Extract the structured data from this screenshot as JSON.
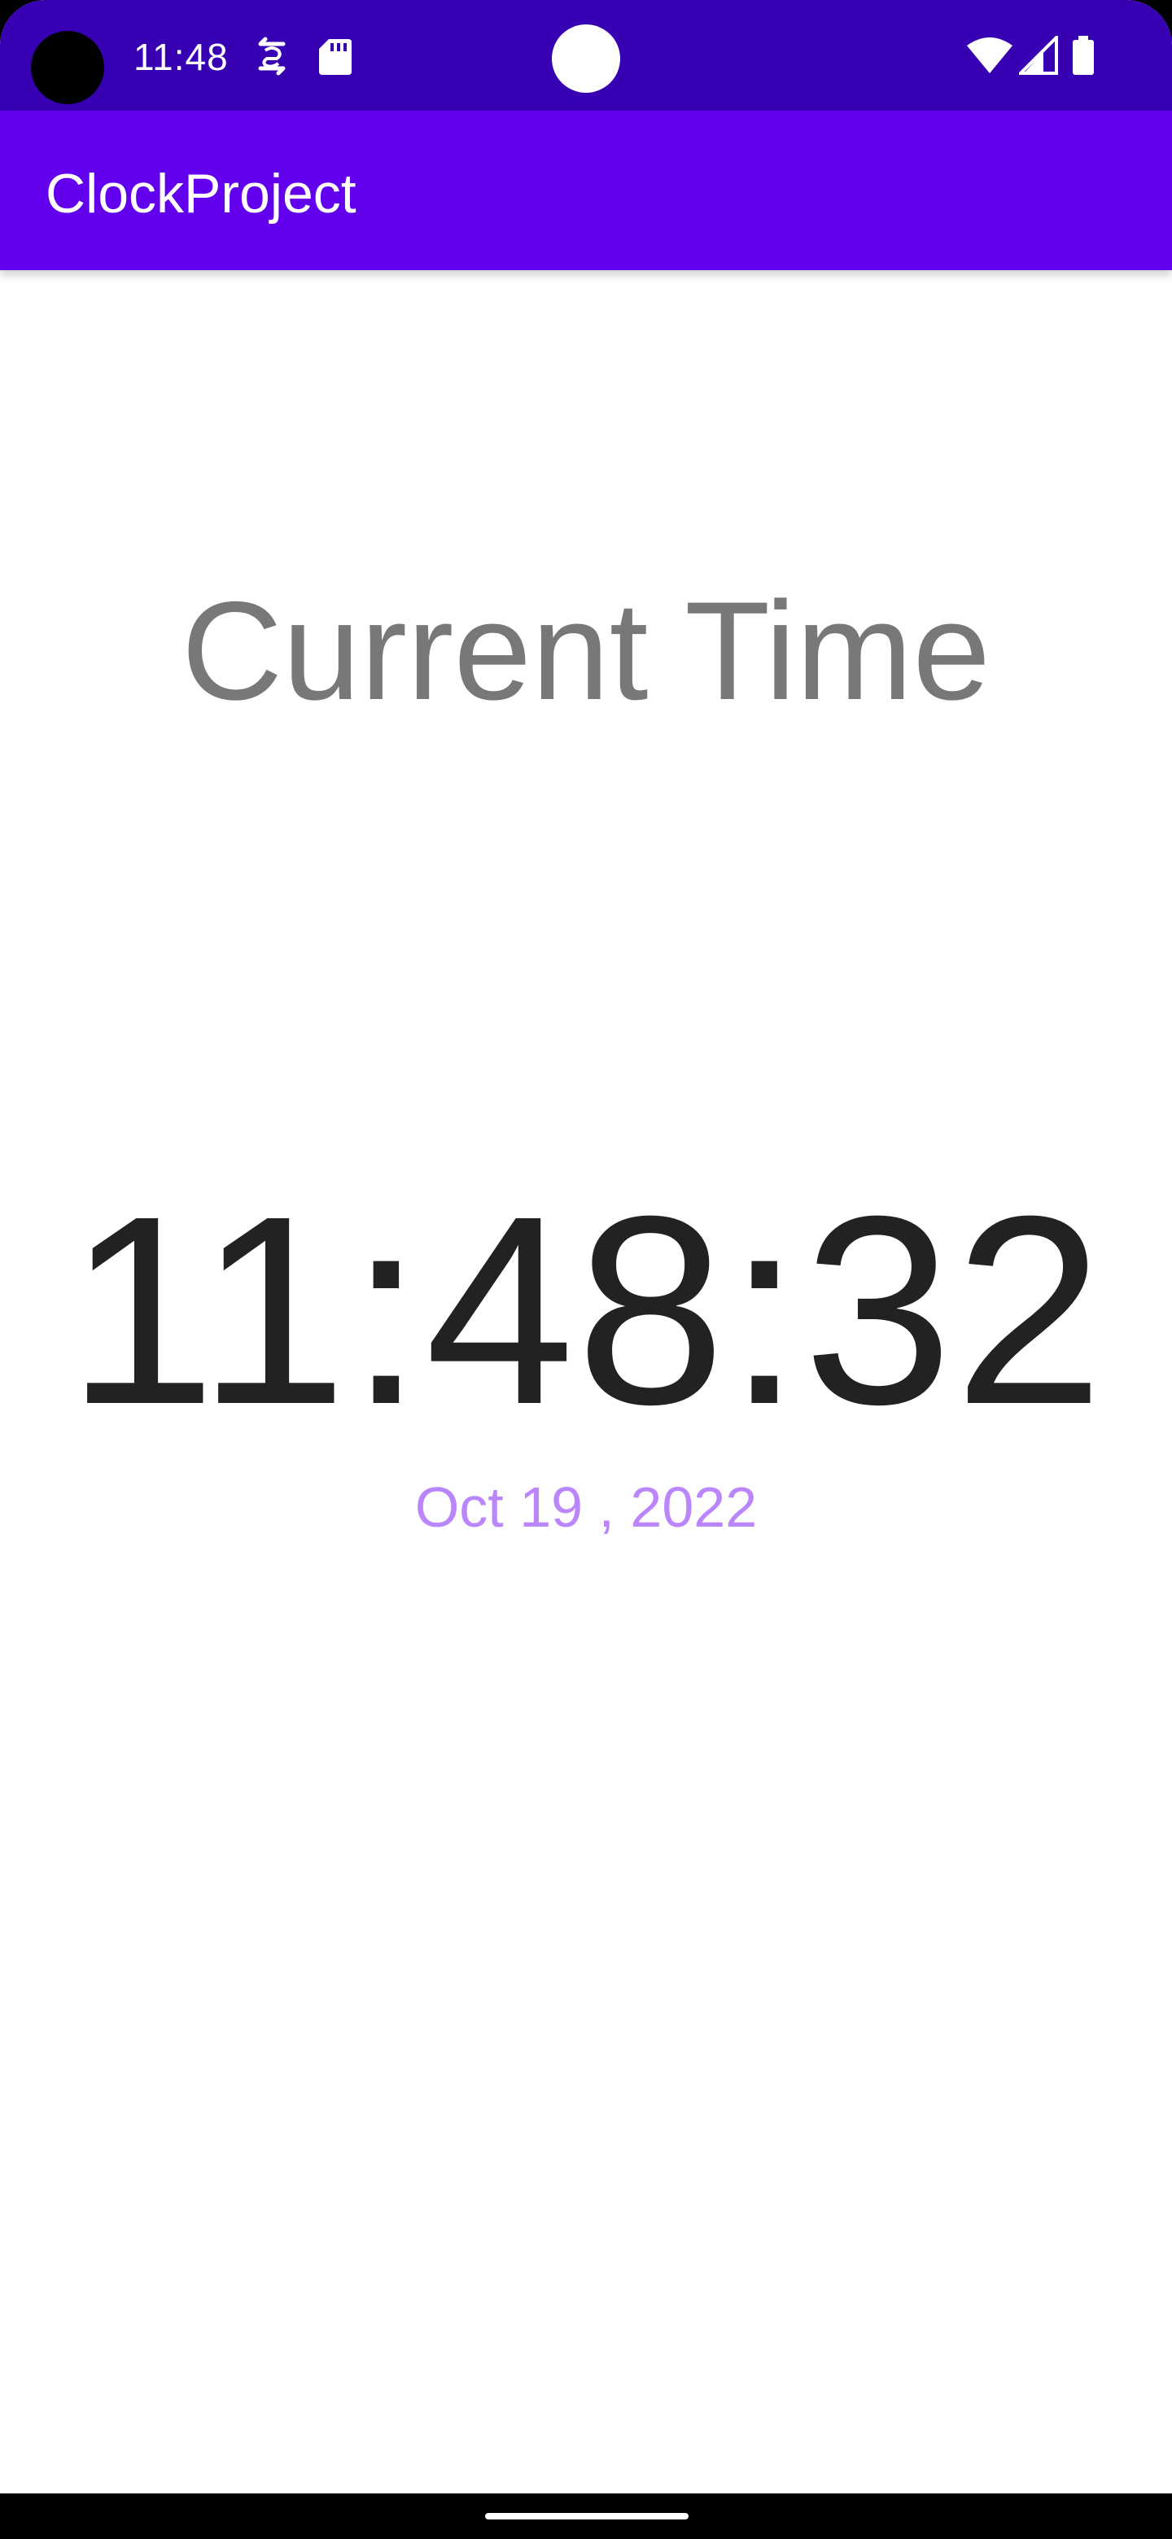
{
  "status_bar": {
    "time": "11:48",
    "left_icons": [
      "sync-icon",
      "sd-card-icon"
    ],
    "right_icons": [
      "wifi-icon",
      "cell-signal-icon",
      "battery-icon"
    ]
  },
  "app_bar": {
    "title": "ClockProject",
    "color": "#6200ee",
    "status_color": "#3700b3"
  },
  "main": {
    "heading": "Current Time",
    "time": "11:48:32",
    "date": "Oct 19 , 2022",
    "date_color": "#bb86fc"
  }
}
